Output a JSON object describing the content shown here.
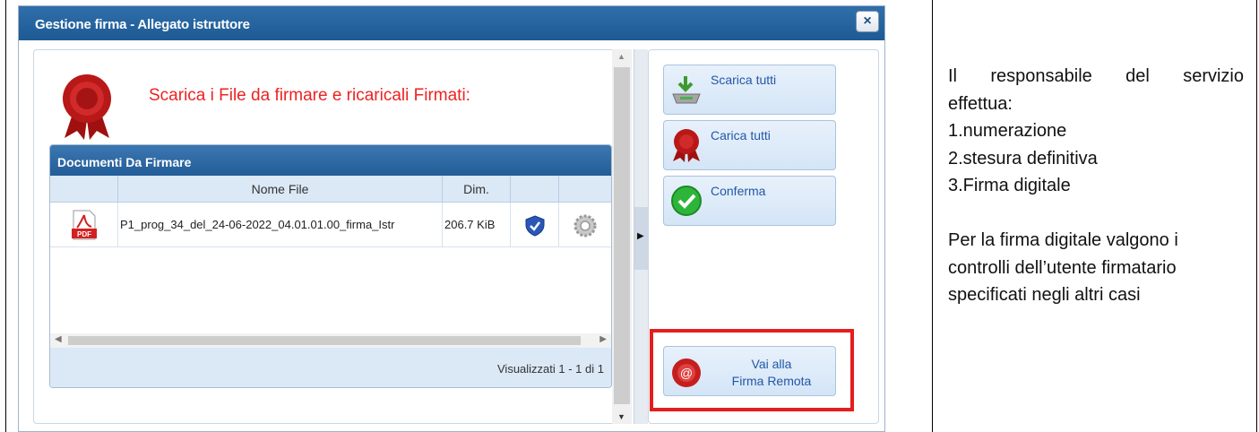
{
  "dialog": {
    "title": "Gestione firma - Allegato istruttore",
    "close_label": "×",
    "heading": "Scarica i File da firmare e ricaricali Firmati:"
  },
  "grid": {
    "title": "Documenti Da Firmare",
    "columns": [
      "",
      "Nome File",
      "Dim.",
      "",
      ""
    ],
    "rows": [
      {
        "icon": "pdf-icon",
        "filename": "P1_prog_34_del_24-06-2022_04.01.01.00_firma_Istr",
        "size": "206.7 KiB"
      }
    ],
    "footer": "Visualizzati 1 - 1 di 1"
  },
  "actions": {
    "download_all": "Scarica tutti",
    "upload_all": "Carica tutti",
    "confirm": "Conferma",
    "remote_line1": "Vai alla",
    "remote_line2": "Firma Remota"
  },
  "info": {
    "line1": "Il responsabile del servizio",
    "line2": "effettua:",
    "line3": "1.numerazione",
    "line4": "2.stesura definitiva",
    "line5": "3.Firma digitale",
    "line6": "Per la firma digitale valgono i",
    "line7": "controlli dell’utente firmatario",
    "line8": "specificati negli altri casi"
  },
  "colors": {
    "titlebar": "#2f6fab",
    "heading": "#ee2222",
    "highlight": "#e41e1e",
    "button_text": "#2257a6"
  }
}
